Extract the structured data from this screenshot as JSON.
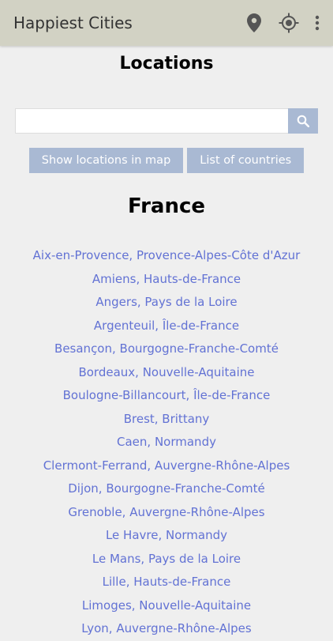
{
  "appbar": {
    "title": "Happiest Cities",
    "icons": [
      "location-pin-icon",
      "my-location-icon",
      "more-vert-icon"
    ],
    "background": "#d2d2c4"
  },
  "page": {
    "title": "Locations",
    "background": "#efefef"
  },
  "search": {
    "placeholder": "",
    "value": "",
    "button_icon": "search-icon"
  },
  "buttons": {
    "show_map_label": "Show locations in map",
    "list_countries_label": "List of countries",
    "color": "#a9b9d3"
  },
  "country": {
    "name": "France"
  },
  "locations": [
    "Aix-en-Provence, Provence-Alpes-Côte d'Azur",
    "Amiens, Hauts-de-France",
    "Angers, Pays de la Loire",
    "Argenteuil, Île-de-France",
    "Besançon, Bourgogne-Franche-Comté",
    "Bordeaux, Nouvelle-Aquitaine",
    "Boulogne-Billancourt, Île-de-France",
    "Brest, Brittany",
    "Caen, Normandy",
    "Clermont-Ferrand, Auvergne-Rhône-Alpes",
    "Dijon, Bourgogne-Franche-Comté",
    "Grenoble, Auvergne-Rhône-Alpes",
    "Le Havre, Normandy",
    "Le Mans, Pays de la Loire",
    "Lille, Hauts-de-France",
    "Limoges, Nouvelle-Aquitaine",
    "Lyon, Auvergne-Rhône-Alpes"
  ],
  "link_color": "#6272d4"
}
